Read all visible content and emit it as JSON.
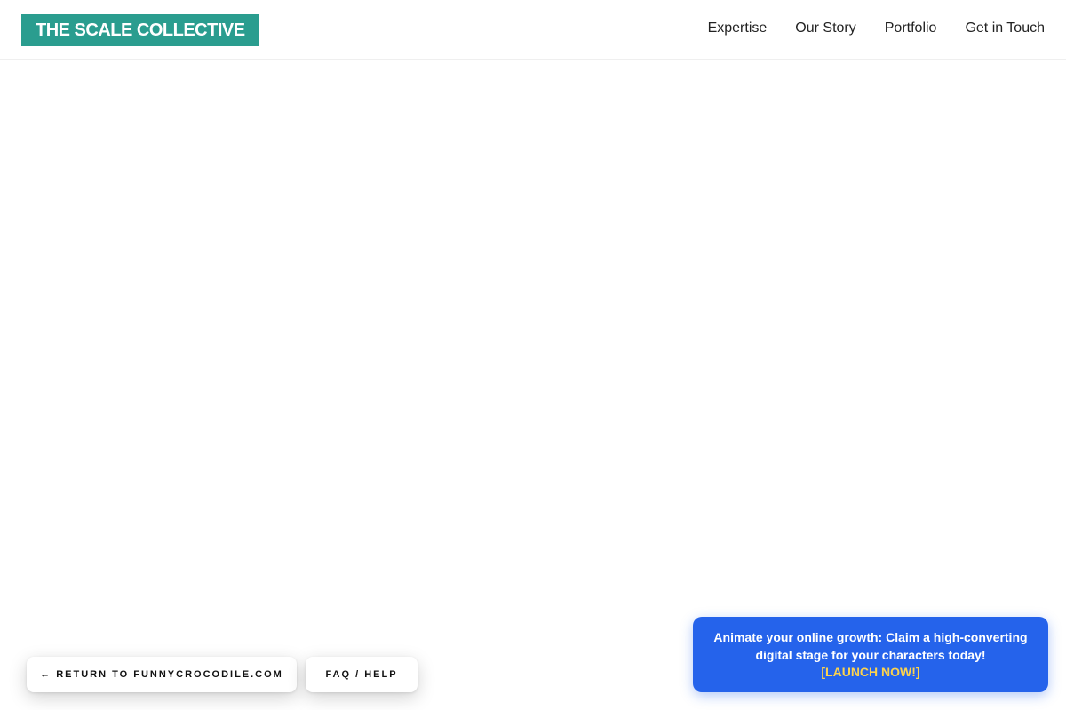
{
  "header": {
    "logo_text": "THE SCALE COLLECTIVE",
    "nav": [
      {
        "label": "Expertise"
      },
      {
        "label": "Our Story"
      },
      {
        "label": "Portfolio"
      },
      {
        "label": "Get in Touch"
      }
    ]
  },
  "footer_buttons": {
    "return_label": "← RETURN TO FUNNYCROCODILE.COM",
    "faq_label": "FAQ / HELP"
  },
  "promo": {
    "message": "Animate your online growth: Claim a high-converting digital stage for your characters today!",
    "cta_label": "[LAUNCH NOW!]"
  },
  "colors": {
    "brand": "#2a9d8f",
    "promo_background": "#2563eb",
    "cta": "#fcd34d"
  }
}
